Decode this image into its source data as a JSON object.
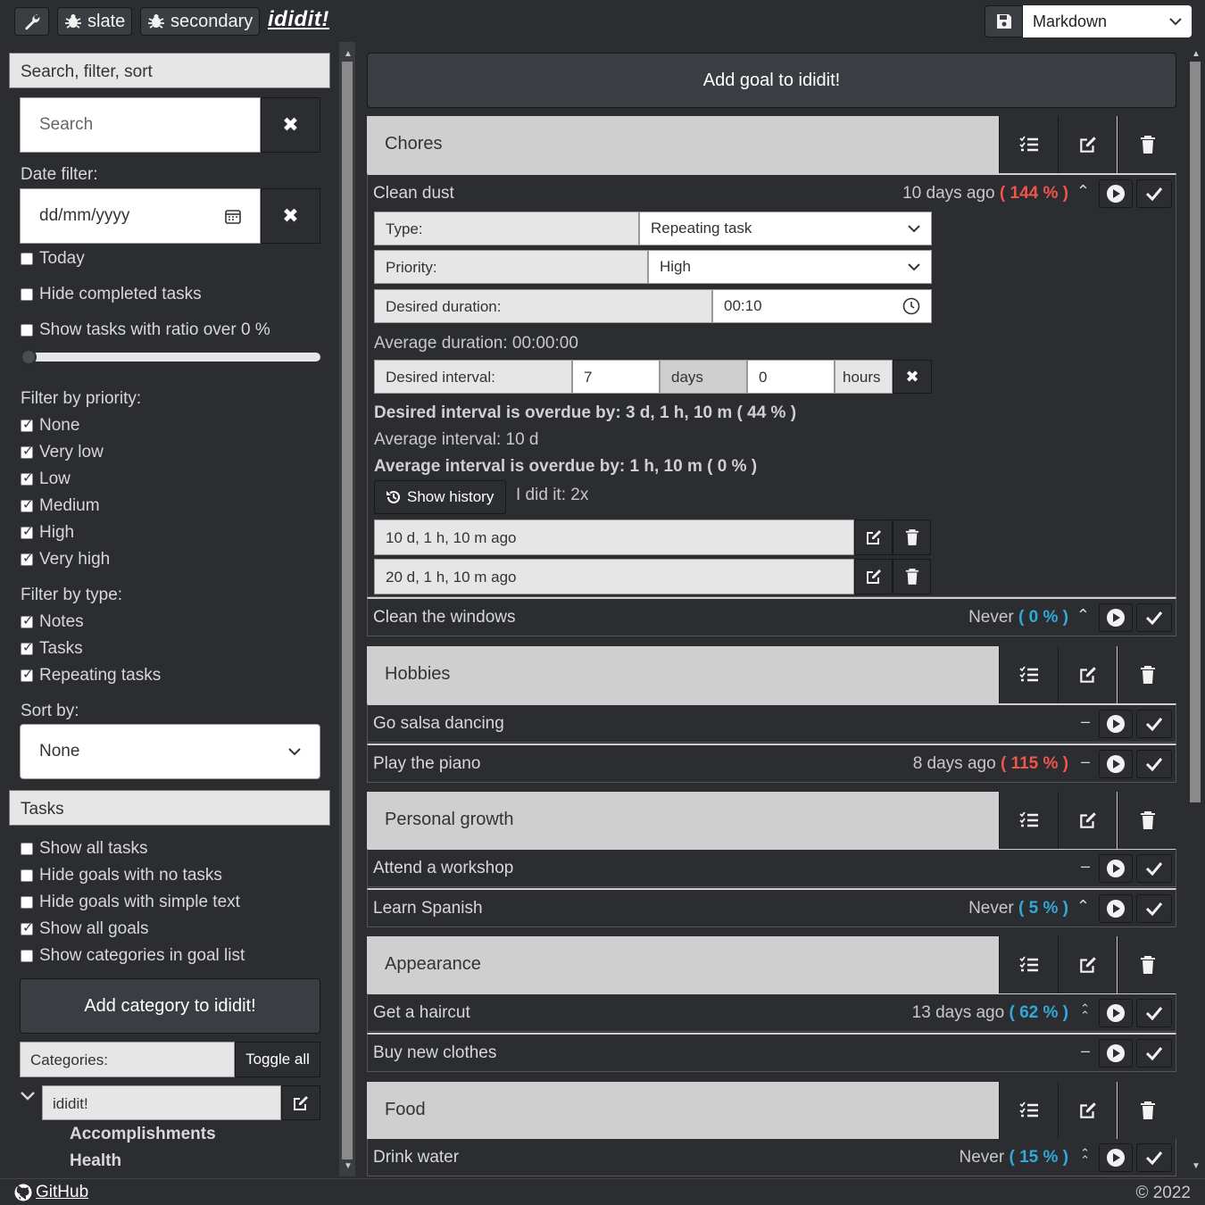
{
  "topbar": {
    "tools_label": "",
    "btn_slate": "slate",
    "btn_secondary": "secondary",
    "brand": "ididit!",
    "format_select": "Markdown"
  },
  "sidebar": {
    "search_header": "Search, filter, sort",
    "search_placeholder": "Search",
    "date_filter_label": "Date filter:",
    "date_placeholder": "dd/mm/yyyy",
    "today": "Today",
    "hide_completed": "Hide completed tasks",
    "show_ratio": "Show tasks with ratio over 0 %",
    "filter_priority_label": "Filter by priority:",
    "priorities": [
      {
        "label": "None",
        "checked": true
      },
      {
        "label": "Very low",
        "checked": true
      },
      {
        "label": "Low",
        "checked": true
      },
      {
        "label": "Medium",
        "checked": true
      },
      {
        "label": "High",
        "checked": true
      },
      {
        "label": "Very high",
        "checked": true
      }
    ],
    "filter_type_label": "Filter by type:",
    "types": [
      {
        "label": "Notes",
        "checked": true
      },
      {
        "label": "Tasks",
        "checked": true
      },
      {
        "label": "Repeating tasks",
        "checked": true
      }
    ],
    "sort_label": "Sort by:",
    "sort_value": "None",
    "tasks_header": "Tasks",
    "task_options": [
      {
        "label": "Show all tasks",
        "checked": false
      },
      {
        "label": "Hide goals with no tasks",
        "checked": false
      },
      {
        "label": "Hide goals with simple text",
        "checked": false
      },
      {
        "label": "Show all goals",
        "checked": true
      },
      {
        "label": "Show categories in goal list",
        "checked": false
      }
    ],
    "add_category": "Add category to ididit!",
    "categories_label": "Categories:",
    "toggle_all": "Toggle all",
    "category_name": "ididit!",
    "category_items": [
      "Accomplishments",
      "Health"
    ]
  },
  "main": {
    "add_goal": "Add goal to ididit!",
    "goals": [
      {
        "title": "Chores"
      },
      {
        "title": "Hobbies"
      },
      {
        "title": "Personal growth"
      },
      {
        "title": "Appearance"
      },
      {
        "title": "Food"
      }
    ],
    "tasks": [
      {
        "name": "Clean dust",
        "meta": "10 days ago",
        "ratio": "( 144 % )",
        "ratio_color": "red"
      },
      {
        "name": "Clean the windows",
        "meta": "Never",
        "ratio": "( 0 % )",
        "ratio_color": "blue"
      },
      {
        "name": "Go salsa dancing",
        "meta": "",
        "ratio": "",
        "ratio_color": ""
      },
      {
        "name": "Play the piano",
        "meta": "8 days ago",
        "ratio": "( 115 % )",
        "ratio_color": "red"
      },
      {
        "name": "Attend a workshop",
        "meta": "",
        "ratio": "",
        "ratio_color": ""
      },
      {
        "name": "Learn Spanish",
        "meta": "Never",
        "ratio": "( 5 % )",
        "ratio_color": "blue"
      },
      {
        "name": "Get a haircut",
        "meta": "13 days ago",
        "ratio": "( 62 % )",
        "ratio_color": "blue"
      },
      {
        "name": "Buy new clothes",
        "meta": "",
        "ratio": "",
        "ratio_color": ""
      },
      {
        "name": "Drink water",
        "meta": "Never",
        "ratio": "( 15 % )",
        "ratio_color": "blue"
      }
    ],
    "detail": {
      "type_label": "Type:",
      "type_value": "Repeating task",
      "priority_label": "Priority:",
      "priority_value": "High",
      "duration_label": "Desired duration:",
      "duration_value": "00:10",
      "average_duration": "Average duration: 00:00:00",
      "interval_label": "Desired interval:",
      "interval_days": "7",
      "days_label": "days",
      "interval_hours": "0",
      "hours_label": "hours",
      "overdue_desired": "Desired interval is overdue by: 3 d, 1 h, 10 m ( 44 % )",
      "average_interval": "Average interval: 10 d",
      "overdue_average": "Average interval is overdue by: 1 h, 10 m ( 0 % )",
      "show_history": "Show history",
      "did_it": "I did it: 2x",
      "history": [
        "10 d, 1 h, 10 m ago",
        "20 d, 1 h, 10 m ago"
      ]
    }
  },
  "footer": {
    "github": "GitHub",
    "copyright": "© 2022"
  }
}
